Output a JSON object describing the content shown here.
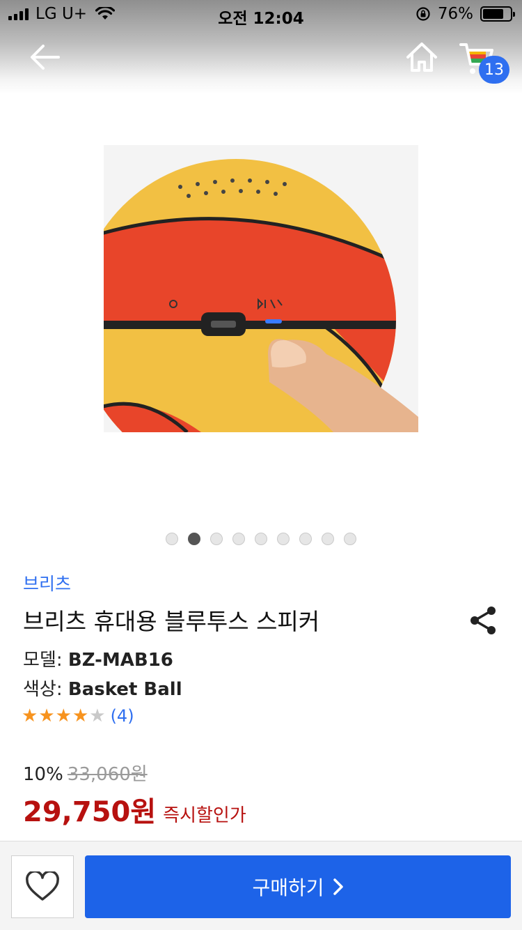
{
  "status_bar": {
    "carrier": "LG U+",
    "time": "오전 12:04",
    "battery": "76%",
    "battery_level": 0.76
  },
  "header": {
    "cart_count": "13",
    "icons": [
      "back-arrow-icon",
      "home-icon",
      "cart-icon"
    ]
  },
  "gallery": {
    "total_slides": 9,
    "active_index": 1
  },
  "product": {
    "brand": "브리츠",
    "title": "브리츠 휴대용 블루투스 스피커",
    "model_label": "모델:",
    "model_value": "BZ-MAB16",
    "color_label": "색상:",
    "color_value": "Basket Ball",
    "rating_stars": 4,
    "rating_max": 5,
    "review_count": "(4)"
  },
  "pricing": {
    "discount": "10%",
    "original_price": "33,060원",
    "price": "29,750원",
    "price_note": "즉시할인가"
  },
  "bottom_bar": {
    "buy_label": "구매하기"
  },
  "colors": {
    "accent_blue": "#1d63e8",
    "brand_link": "#2f6ff0",
    "price_red": "#b7110f",
    "star": "#f7931e"
  }
}
